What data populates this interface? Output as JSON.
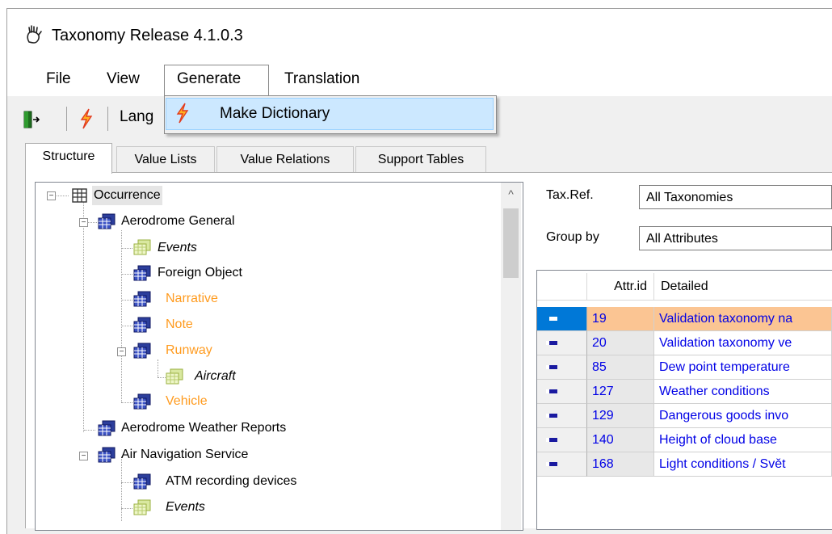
{
  "window": {
    "title": "Taxonomy Release 4.1.0.3",
    "app_icon": "hand-icon"
  },
  "menu": [
    {
      "label": "File"
    },
    {
      "label": "View"
    },
    {
      "label": "Generate",
      "open": true
    },
    {
      "label": "Translation"
    }
  ],
  "toolbar": {
    "partial_label": "Lang",
    "icons": [
      "exit-door-icon",
      "lightning-icon"
    ]
  },
  "dropdown": {
    "items": [
      {
        "label": "Make Dictionary",
        "icon": "lightning-icon",
        "highlighted": true
      }
    ]
  },
  "tabs": [
    {
      "label": "Structure",
      "active": true
    },
    {
      "label": "Value Lists"
    },
    {
      "label": "Value Relations"
    },
    {
      "label": "Support Tables"
    }
  ],
  "tree": {
    "nodes": [
      {
        "label": "Occurrence",
        "style": "selected",
        "icon": "table-root-icon"
      },
      {
        "label": "Aerodrome General",
        "style": "normal",
        "icon": "table-blue-icon"
      },
      {
        "label": "Events",
        "style": "italic",
        "icon": "table-green-icon"
      },
      {
        "label": "Foreign Object",
        "style": "normal",
        "icon": "table-blue-icon"
      },
      {
        "label": "Narrative",
        "style": "orange",
        "icon": "table-blue-icon"
      },
      {
        "label": "Note",
        "style": "orange",
        "icon": "table-blue-icon"
      },
      {
        "label": "Runway",
        "style": "orange",
        "icon": "table-blue-icon"
      },
      {
        "label": "Aircraft",
        "style": "italic",
        "icon": "table-green-icon"
      },
      {
        "label": "Vehicle",
        "style": "orange",
        "icon": "table-blue-icon"
      },
      {
        "label": "Aerodrome Weather Reports",
        "style": "normal",
        "icon": "table-blue-icon"
      },
      {
        "label": "Air Navigation Service",
        "style": "normal",
        "icon": "table-blue-icon"
      },
      {
        "label": "ATM recording devices",
        "style": "normal",
        "icon": "table-blue-icon"
      },
      {
        "label": "Events",
        "style": "italic",
        "icon": "table-green-icon"
      }
    ]
  },
  "filters": {
    "taxref_label": "Tax.Ref.",
    "taxref_value": "All Taxonomies",
    "groupby_label": "Group by",
    "groupby_value": "All Attributes"
  },
  "grid": {
    "columns": [
      "Attr.id",
      "Detailed"
    ],
    "rows": [
      {
        "id": "19",
        "detailed": "Validation taxonomy na",
        "selected": true
      },
      {
        "id": "20",
        "detailed": "Validation taxonomy ve"
      },
      {
        "id": "85",
        "detailed": "Dew point temperature"
      },
      {
        "id": "127",
        "detailed": "Weather conditions"
      },
      {
        "id": "129",
        "detailed": "Dangerous goods invo"
      },
      {
        "id": "140",
        "detailed": "Height of cloud base"
      },
      {
        "id": "168",
        "detailed": "Light conditions / Svět"
      }
    ]
  },
  "colors": {
    "orange_text": "#ff9b1f",
    "link_blue": "#0000e6",
    "selected_row": "#fbc593",
    "menu_highlight": "#cce8ff"
  }
}
